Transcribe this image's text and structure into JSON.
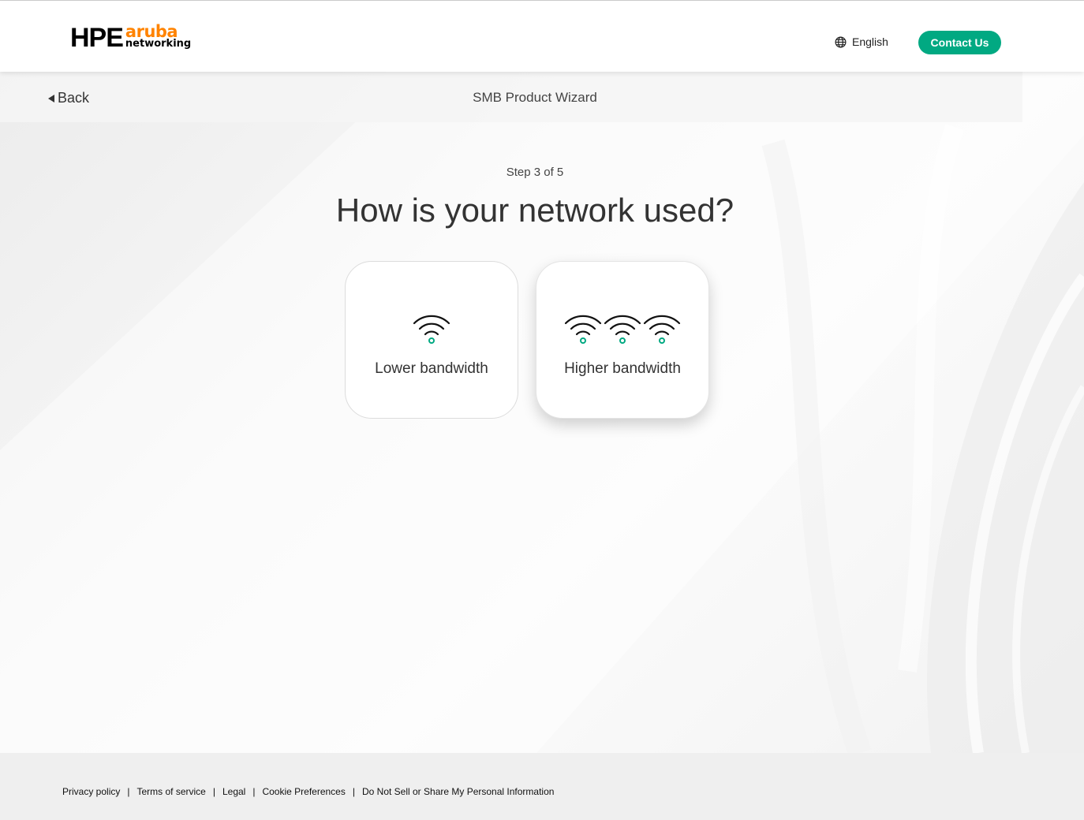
{
  "header": {
    "logo": {
      "hpe": "HPE",
      "aruba": "aruba",
      "networking": "networking"
    },
    "language": {
      "label": "English",
      "icon": "globe-icon"
    },
    "contact_label": "Contact Us"
  },
  "subbar": {
    "back_label": "Back",
    "title": "SMB Product Wizard"
  },
  "main": {
    "step": "Step 3 of 5",
    "question": "How is your network used?",
    "options": [
      {
        "label": "Lower bandwidth",
        "icon": "wifi-icon",
        "icon_count": 1,
        "selected": false
      },
      {
        "label": "Higher bandwidth",
        "icon": "wifi-icon",
        "icon_count": 3,
        "selected": true
      }
    ]
  },
  "footer": {
    "links": [
      "Privacy policy",
      "Terms of service",
      "Legal",
      "Cookie Preferences",
      "Do Not Sell or Share My Personal Information"
    ],
    "separator": "|"
  },
  "colors": {
    "accent": "#01a982",
    "brand_orange": "#ff8300",
    "text": "#333333"
  }
}
